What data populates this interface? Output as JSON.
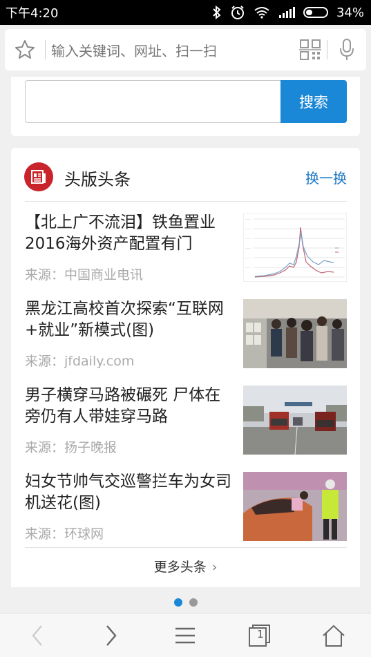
{
  "status_bar": {
    "time": "下午4:20",
    "battery": "34%",
    "battery_level": 0.34
  },
  "address_bar": {
    "placeholder": "输入关键词、网址、扫一扫",
    "icons": [
      "star-icon",
      "qr-scan-icon",
      "microphone-icon"
    ]
  },
  "search_box": {
    "value": "",
    "button_label": "搜索"
  },
  "news": {
    "section_title": "头版头条",
    "refresh_label": "换一换",
    "more_label": "更多头条",
    "items": [
      {
        "headline": "【北上广不流泪】铁鱼置业2016海外资产配置有门",
        "source": "来源：中国商业电讯",
        "thumb": "line-chart-thumbnail"
      },
      {
        "headline": "黑龙江高校首次探索“互联网+就业”新模式(图)",
        "source": "来源：jfdaily.com",
        "thumb": "job-fair-photo"
      },
      {
        "headline": "男子横穿马路被碾死 尸体在旁仍有人带娃穿马路",
        "source": "来源：扬子晚报",
        "thumb": "highway-trucks-photo"
      },
      {
        "headline": "妇女节帅气交巡警拦车为女司机送花(图)",
        "source": "来源：环球网",
        "thumb": "police-flowers-photo"
      }
    ]
  },
  "pager": {
    "pages": 2,
    "current": 1
  },
  "bottom_toolbar": {
    "tab_count": "1",
    "buttons": [
      "back-icon",
      "forward-icon",
      "menu-icon",
      "tabs-icon",
      "home-icon"
    ]
  },
  "colors": {
    "accent_blue": "#1a87d7",
    "link_blue": "#1a76c5",
    "brand_red": "#c9242b"
  }
}
